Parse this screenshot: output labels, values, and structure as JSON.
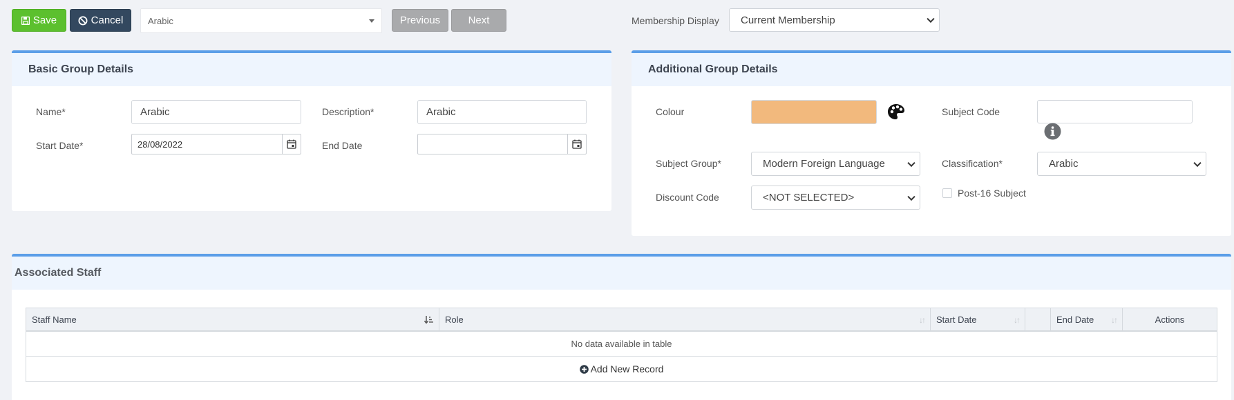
{
  "toolbar": {
    "save_label": "Save",
    "cancel_label": "Cancel",
    "group_select_value": "Arabic",
    "previous_label": "Previous",
    "next_label": "Next",
    "membership_display_label": "Membership Display",
    "membership_display_value": "Current Membership"
  },
  "basic": {
    "title": "Basic Group Details",
    "name_label": "Name*",
    "name_value": "Arabic",
    "description_label": "Description*",
    "description_value": "Arabic",
    "start_date_label": "Start Date*",
    "start_date_value": "28/08/2022",
    "end_date_label": "End Date",
    "end_date_value": ""
  },
  "additional": {
    "title": "Additional Group Details",
    "colour_label": "Colour",
    "colour_value": "#f2b97d",
    "subject_code_label": "Subject Code",
    "subject_code_value": "",
    "subject_group_label": "Subject Group*",
    "subject_group_value": "Modern Foreign Language",
    "classification_label": "Classification*",
    "classification_value": "Arabic",
    "discount_code_label": "Discount Code",
    "discount_code_value": "<NOT SELECTED>",
    "post16_label": "Post-16 Subject",
    "post16_checked": false
  },
  "staff": {
    "title": "Associated Staff",
    "columns": [
      "Staff Name",
      "Role",
      "Start Date",
      "",
      "End Date",
      "Actions"
    ],
    "empty_text": "No data available in table",
    "add_label": "Add New Record"
  },
  "colors": {
    "accent": "#5b9ee8",
    "save": "#5cc02e",
    "cancel": "#33485f",
    "nav_button": "#a9aaac"
  }
}
